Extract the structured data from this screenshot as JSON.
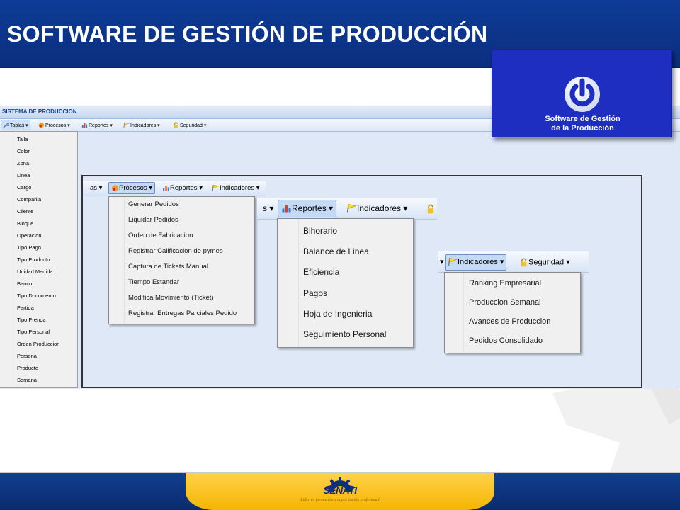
{
  "slide": {
    "title": "SOFTWARE DE GESTIÓN DE PRODUCCIÓN",
    "colors": {
      "header": "#0e3b95",
      "logo_box": "#1e2ec0",
      "footer": "#123f8f",
      "footer_banner": "#f5b400"
    }
  },
  "logo": {
    "icon": "power-icon",
    "line1": "Software de Gestión",
    "line2": "de la Producción"
  },
  "app": {
    "title": "SISTEMA DE PRODUCCION",
    "menubar": {
      "tablas": "Tablas",
      "procesos": "Procesos",
      "reportes": "Reportes",
      "indicadores": "Indicadores",
      "seguridad": "Seguridad"
    },
    "tablas_items": [
      "Talla",
      "Color",
      "Zona",
      "Linea",
      "Cargo",
      "Compañia",
      "Cliente",
      "Bloque",
      "Operacion",
      "Tipo Pago",
      "Tipo Producto",
      "Unidad Medida",
      "Banco",
      "Tipo Documento",
      "Partida",
      "Tipo Prenda",
      "Tipo Personal",
      "Orden Produccion",
      "Persona",
      "Producto",
      "Semana"
    ]
  },
  "zoom": {
    "bar1": {
      "tablas_partial": "as",
      "procesos": "Procesos",
      "reportes": "Reportes",
      "indicadores": "Indicadores"
    },
    "procesos_items": [
      "Generar Pedidos",
      "Liquidar Pedidos",
      "Orden de Fabricacion",
      "Registrar Calificacion de pymes",
      "Captura de Tickets Manual",
      "Tiempo Estandar",
      "Modifica Movimiento (Ticket)",
      "Registrar Entregas Parciales Pedido"
    ],
    "bar2": {
      "procesos_partial": "s",
      "reportes": "Reportes",
      "indicadores": "Indicadores"
    },
    "reportes_items": [
      "Bihorario",
      "Balance de Linea",
      "Eficiencia",
      "Pagos",
      "Hoja de Ingenieria",
      "Seguimiento Personal"
    ],
    "bar3": {
      "indicadores": "Indicadores",
      "seguridad": "Seguridad"
    },
    "indicadores_items": [
      "Ranking Empresarial",
      "Produccion Semanal",
      "Avances de Produccion",
      "Pedidos Consolidado"
    ]
  },
  "footer": {
    "brand": "SENATI",
    "tagline": "Líder en formación y capacitación profesional",
    "icon": "gear-icon"
  }
}
